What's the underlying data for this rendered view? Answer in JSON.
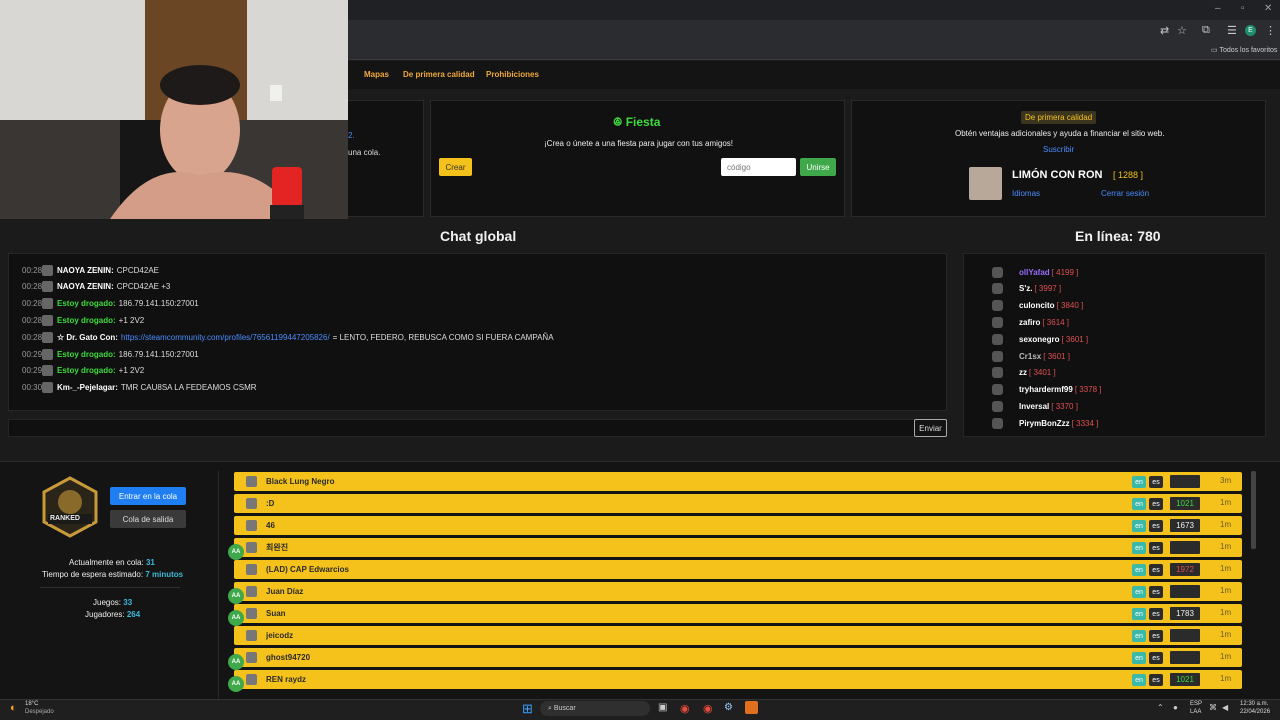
{
  "browser": {
    "bookmarks_label": "Todos los favoritos",
    "profile_initial": "E"
  },
  "nav": {
    "links": [
      "Mapas",
      "De primera calidad",
      "Prohibiciones"
    ]
  },
  "left_card": {
    "fragment_link": "2.",
    "fragment_text": "una cola."
  },
  "party": {
    "title": "Fiesta",
    "description": "¡Crea o únete a una fiesta para jugar con tus amigos!",
    "create_label": "Crear",
    "code_placeholder": "código",
    "join_label": "Unirse"
  },
  "premium": {
    "badge": "De primera calidad",
    "description": "Obtén ventajas adicionales y ayuda a financiar el sitio web.",
    "subscribe": "Suscribir",
    "user_name": "LIMÓN CON RON",
    "user_elo": "1288",
    "languages": "Idiomas",
    "logout": "Cerrar sesión"
  },
  "chat": {
    "title": "Chat global",
    "send_label": "Enviar",
    "messages": [
      {
        "time": "00:28",
        "user": "NAOYA ZENIN:",
        "text": "CPCD42AE",
        "color": "#ffffff"
      },
      {
        "time": "00:28",
        "user": "NAOYA ZENIN:",
        "text": "CPCD42AE +3",
        "color": "#ffffff"
      },
      {
        "time": "00:28",
        "user": "Estoy drogado:",
        "text": "186.79.141.150:27001",
        "color": "#3ddc3d"
      },
      {
        "time": "00:28",
        "user": "Estoy drogado:",
        "text": "+1 2V2",
        "color": "#3ddc3d"
      },
      {
        "time": "00:28",
        "user": "☆ Dr. Gato Con:",
        "link": "https://steamcommunity.com/profiles/76561199447205826/",
        "text": "= LENTO, FEDERO, REBUSCA COMO SI FUERA CAMPAÑA",
        "color": "#ffffff"
      },
      {
        "time": "00:29",
        "user": "Estoy drogado:",
        "text": "186.79.141.150:27001",
        "color": "#3ddc3d"
      },
      {
        "time": "00:29",
        "user": "Estoy drogado:",
        "text": "+1 2V2",
        "color": "#3ddc3d"
      },
      {
        "time": "00:30",
        "user": "Km-_-Pejelagar:",
        "text": "TMR CAU8SA LA FEDEAMOS CSMR",
        "color": "#ffffff"
      }
    ]
  },
  "online": {
    "title": "En línea: 780",
    "users": [
      {
        "name": "ollYafad",
        "elo": "[ 4199 ]",
        "color": "#9a6cff"
      },
      {
        "name": "S'z.",
        "elo": "[ 3997 ]",
        "color": "#ffffff"
      },
      {
        "name": "culoncito",
        "elo": "[ 3840 ]",
        "color": "#ffffff"
      },
      {
        "name": "zafiro",
        "elo": "[ 3614 ]",
        "color": "#ffffff"
      },
      {
        "name": "sexonegro",
        "elo": "[ 3601 ]",
        "color": "#ffffff"
      },
      {
        "name": "Cr1sx",
        "elo": "[ 3601 ]",
        "color": "#bbbbbb"
      },
      {
        "name": "zz",
        "elo": "[ 3401 ]",
        "color": "#ffffff"
      },
      {
        "name": "tryhardermf99",
        "elo": "[ 3378 ]",
        "color": "#ffffff"
      },
      {
        "name": "Inversal",
        "elo": "[ 3370 ]",
        "color": "#ffffff"
      },
      {
        "name": "PirymBonZzz",
        "elo": "[ 3334 ]",
        "color": "#ffffff"
      }
    ]
  },
  "queue": {
    "logo_text": "RANKED",
    "enter_label": "Entrar en la cola",
    "leave_label": "Cola de salida",
    "in_queue_label": "Actualmente en cola:",
    "in_queue_value": "31",
    "wait_label": "Tiempo de espera estimado:",
    "wait_value": "7 minutos",
    "games_label": "Juegos:",
    "games_value": "33",
    "players_label": "Jugadores:",
    "players_value": "264",
    "rows": [
      {
        "name": "Black Lung Negro",
        "lang1": "en",
        "lang2": "es",
        "elo": "",
        "time": "3m",
        "aa": false
      },
      {
        "name": ":D",
        "lang1": "en",
        "lang2": "es",
        "elo": "1021",
        "time": "1m",
        "aa": false
      },
      {
        "name": "46",
        "lang1": "en",
        "lang2": "es",
        "elo": "1673",
        "time": "1m",
        "aa": false
      },
      {
        "name": "최완진",
        "lang1": "en",
        "lang2": "es",
        "elo": "",
        "time": "1m",
        "aa": true
      },
      {
        "name": "(LAD) CAP Edwarcios",
        "lang1": "en",
        "lang2": "es",
        "elo": "1972",
        "time": "1m",
        "aa": false
      },
      {
        "name": "Juan Díaz",
        "lang1": "en",
        "lang2": "es",
        "elo": "",
        "time": "1m",
        "aa": true
      },
      {
        "name": "Suan",
        "lang1": "en",
        "lang2": "es",
        "elo": "1783",
        "time": "1m",
        "aa": true
      },
      {
        "name": "jeicodz",
        "lang1": "en",
        "lang2": "es",
        "elo": "",
        "time": "1m",
        "aa": false
      },
      {
        "name": "ghost94720",
        "lang1": "en",
        "lang2": "es",
        "elo": "",
        "time": "1m",
        "aa": true
      },
      {
        "name": "REN raydz",
        "lang1": "en",
        "lang2": "es",
        "elo": "1021",
        "time": "1m",
        "aa": true
      }
    ]
  },
  "taskbar": {
    "weather_temp": "18°C",
    "weather_desc": "Despejado",
    "search": "Buscar",
    "lang_top": "ESP",
    "lang_bottom": "LAA",
    "time": "12:30 a.m.",
    "date": "22/04/2026"
  }
}
